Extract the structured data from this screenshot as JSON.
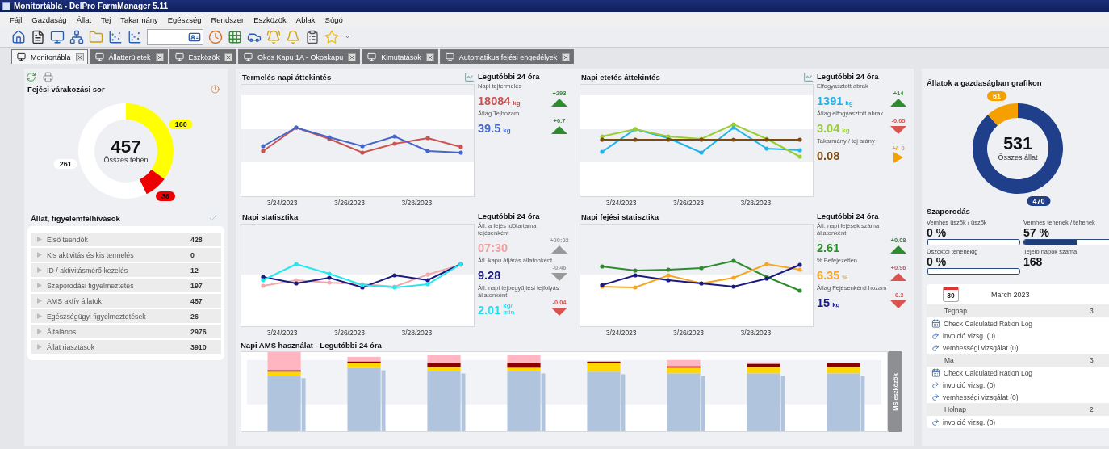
{
  "window": {
    "title": "Monitortábla - DelPro FarmManager 5.11"
  },
  "menu": [
    "Fájl",
    "Gazdaság",
    "Állat",
    "Tej",
    "Takarmány",
    "Egészség",
    "Rendszer",
    "Eszközök",
    "Ablak",
    "Súgó"
  ],
  "tabs": [
    {
      "label": "Monitortábla",
      "selected": true
    },
    {
      "label": "Állatterületek",
      "selected": false
    },
    {
      "label": "Eszközök",
      "selected": false
    },
    {
      "label": "Okos Kapu 1A - Okoskapu",
      "selected": false
    },
    {
      "label": "Kimutatások",
      "selected": false
    },
    {
      "label": "Automatikus fejési engedélyek",
      "selected": false
    }
  ],
  "queue": {
    "title": "Fejési várakozási sor",
    "total": "457",
    "total_label": "Összes tehén",
    "chart_data": {
      "type": "donut",
      "values": [
        160,
        36,
        261
      ],
      "data_labels": true,
      "value_labels": [
        "160",
        "36",
        "261"
      ]
    }
  },
  "alerts": {
    "title": "Állat, figyelemfelhívások",
    "items": [
      {
        "label": "Első teendők",
        "count": "428"
      },
      {
        "label": "Kis aktivitás és kis termelés",
        "count": "0"
      },
      {
        "label": "ID / aktivitásmérő kezelés",
        "count": "12"
      },
      {
        "label": "Szaporodási figyelmeztetés",
        "count": "197"
      },
      {
        "label": "AMS aktív állatok",
        "count": "457"
      },
      {
        "label": "Egészségügyi figyelmeztetések",
        "count": "26"
      },
      {
        "label": "Általános",
        "count": "2976"
      },
      {
        "label": "Állat riasztások",
        "count": "3910"
      }
    ]
  },
  "panels": [
    {
      "title": "Termelés napi áttekintés",
      "kind": "production",
      "chart_button": true,
      "dates": [
        "3/24/2023",
        "3/26/2023",
        "3/28/2023"
      ],
      "stats_title": "Legutóbbi 24 óra",
      "stats": [
        {
          "label": "Napi tejtermelés",
          "value": "18084",
          "unit": "kg",
          "color": "#c9534f",
          "change": {
            "text": "+293",
            "kind": "up",
            "color": "#2e8b2e"
          }
        },
        {
          "label": "Átlag Tejhozam",
          "value": "39.5",
          "unit": "kg",
          "color": "#4466cc",
          "change": {
            "text": "+0.7",
            "kind": "up",
            "color": "#2e8b2e"
          }
        }
      ]
    },
    {
      "title": "Napi etetés áttekintés",
      "kind": "feeding",
      "chart_button": true,
      "dates": [
        "3/24/2023",
        "3/26/2023",
        "3/28/2023"
      ],
      "stats_title": "Legutóbbi 24 óra",
      "stats": [
        {
          "label": "Elfogyasztott abrak",
          "value": "1391",
          "unit": "kg",
          "color": "#1fb5ea",
          "change": {
            "text": "+14",
            "kind": "up",
            "color": "#2e8b2e"
          }
        },
        {
          "label": "Átlag elfogyasztott abrak",
          "value": "3.04",
          "unit": "kg",
          "color": "#9acd32",
          "change": {
            "text": "-0.05",
            "kind": "down",
            "color": "#d9534f"
          }
        },
        {
          "label": "Takarmány / tej arány",
          "value": "0.08",
          "color": "#7a4a12",
          "change": {
            "text": "+/- 0",
            "kind": "right",
            "color": "#f5a000"
          }
        }
      ]
    },
    {
      "title": "Napi statisztika",
      "kind": "daily",
      "chart_button": false,
      "dates": [
        "3/24/2023",
        "3/26/2023",
        "3/28/2023"
      ],
      "stats_title": "Legutóbbi 24 óra",
      "stats": [
        {
          "label": "Átl. a fejés időtartama fejésenként",
          "value": "07:30",
          "color": "#f0a0a0",
          "change": {
            "text": "+00:02",
            "kind": "up",
            "color": "#999999"
          }
        },
        {
          "label": "Átl. kapu átjárás állatonként",
          "value": "9.28",
          "color": "#1a1a80",
          "change": {
            "text": "-0.46",
            "kind": "down",
            "color": "#999999"
          }
        },
        {
          "label": "Átl. napi tejbegyűjtési tejfolyás állatonként",
          "value": "2.01",
          "unit": "kg/ min",
          "color": "#22e0f0",
          "change": {
            "text": "-0.04",
            "kind": "down",
            "color": "#d9534f"
          }
        }
      ]
    },
    {
      "title": "Napi fejési statisztika",
      "kind": "milking",
      "chart_button": false,
      "dates": [
        "3/24/2023",
        "3/26/2023",
        "3/28/2023"
      ],
      "stats_title": "Legutóbbi 24 óra",
      "stats": [
        {
          "label": "Átl. napi fejések száma állatonként",
          "value": "2.61",
          "color": "#2e8b2e",
          "change": {
            "text": "+0.08",
            "kind": "up",
            "color": "#2e8b2e"
          }
        },
        {
          "label": "% Befejezetlen",
          "value": "6.35",
          "unit": "%",
          "color": "#f5a623",
          "change": {
            "text": "+0.96",
            "kind": "up",
            "color": "#d9534f"
          }
        },
        {
          "label": "Átlag Fejésenkénti hozam",
          "value": "15",
          "unit": "kg",
          "color": "#1a1a80",
          "change": {
            "text": "-0.3",
            "kind": "down",
            "color": "#d9534f"
          }
        }
      ]
    }
  ],
  "ams": {
    "title": "Napi AMS használat - Legutóbbi 24 óra",
    "side_tab": "MS eszközök"
  },
  "animals": {
    "title": "Állatok a gazdaságban grafikon",
    "total": "531",
    "total_label": "Összes állat",
    "chart_data": {
      "type": "donut",
      "values": [
        470,
        61
      ],
      "data_labels": true,
      "value_labels": [
        "470",
        "61"
      ]
    }
  },
  "reproduction": {
    "title": "Szaporodás",
    "metrics": [
      {
        "kind": "bar",
        "label": "Vemhes üszők / üszők",
        "value": "0 %",
        "level": 0
      },
      {
        "kind": "bar",
        "label": "Vemhes tehenek / tehenek",
        "value": "57 %",
        "level": 0.57
      },
      {
        "kind": "bar",
        "label": "Üszőktől tehenekig",
        "value": "0 %",
        "level": 0
      },
      {
        "kind": "plain",
        "label": "Tejelő napok száma",
        "value": "168"
      }
    ]
  },
  "calendar": {
    "day": "30",
    "month": "March 2023",
    "groups": [
      {
        "label": "Tegnap",
        "count": "3",
        "entries": [
          {
            "kind": "log",
            "text": "Check Calculated Ration Log"
          },
          {
            "kind": "task",
            "text": "involció vizsg. (0)"
          },
          {
            "kind": "task",
            "text": "vemhességi vizsgálat (0)"
          }
        ]
      },
      {
        "label": "Ma",
        "count": "3",
        "entries": [
          {
            "kind": "log",
            "text": "Check Calculated Ration Log"
          },
          {
            "kind": "task",
            "text": "involció vizsg. (0)"
          },
          {
            "kind": "task",
            "text": "vemhességi vizsgálat (0)"
          }
        ]
      },
      {
        "label": "Holnap",
        "count": "2",
        "entries": [
          {
            "kind": "task",
            "text": "involció vizsg. (0)"
          }
        ]
      }
    ]
  }
}
